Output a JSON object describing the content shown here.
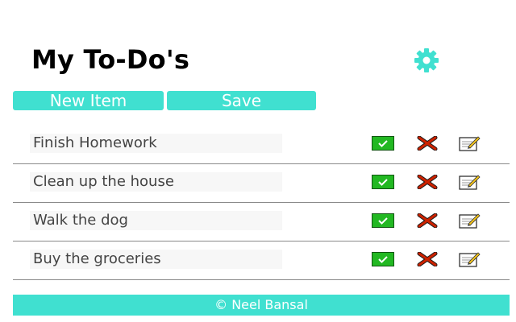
{
  "header": {
    "title": "My To-Do's",
    "settings_icon": "gear-icon"
  },
  "toolbar": {
    "new_item_label": "New Item",
    "save_label": "Save"
  },
  "todos": [
    {
      "text": "Finish Homework"
    },
    {
      "text": "Clean up the house"
    },
    {
      "text": "Walk the dog"
    },
    {
      "text": "Buy the groceries"
    }
  ],
  "row_actions": {
    "complete_icon": "check-icon",
    "delete_icon": "x-icon",
    "edit_icon": "edit-icon"
  },
  "footer": {
    "text": "© Neel Bansal"
  },
  "colors": {
    "accent": "#40e0d0",
    "check_green": "#22b822",
    "delete_red": "#cc2200"
  }
}
